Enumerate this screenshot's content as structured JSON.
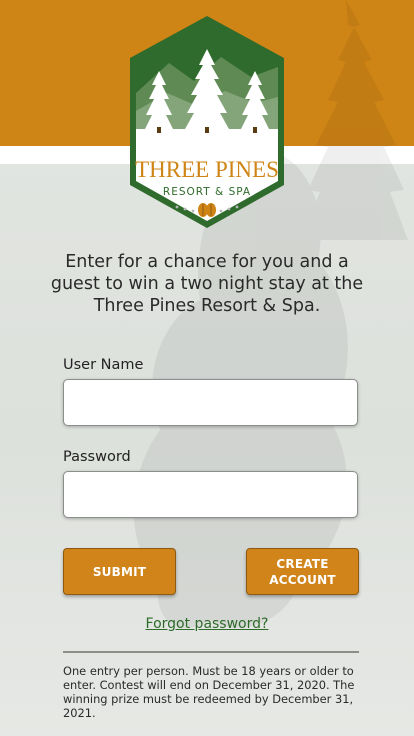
{
  "brand": {
    "name_line1": "THREE PINES",
    "name_line2": "RESORT & SPA",
    "primary_color": "#cf8416",
    "green_color": "#2f6b2c"
  },
  "intro_text": "Enter for a chance for you and a guest to win a two night stay at the Three Pines Resort & Spa.",
  "form": {
    "username_label": "User Name",
    "username_value": "",
    "password_label": "Password",
    "password_value": "",
    "submit_label": "SUBMIT",
    "create_account_line1": "CREATE",
    "create_account_line2": "ACCOUNT"
  },
  "forgot_password": "Forgot password?",
  "fine_print": "One entry per person. Must be 18 years or older to enter. Contest will end on December 31, 2020. The winning prize must be redeemed by December 31, 2021."
}
